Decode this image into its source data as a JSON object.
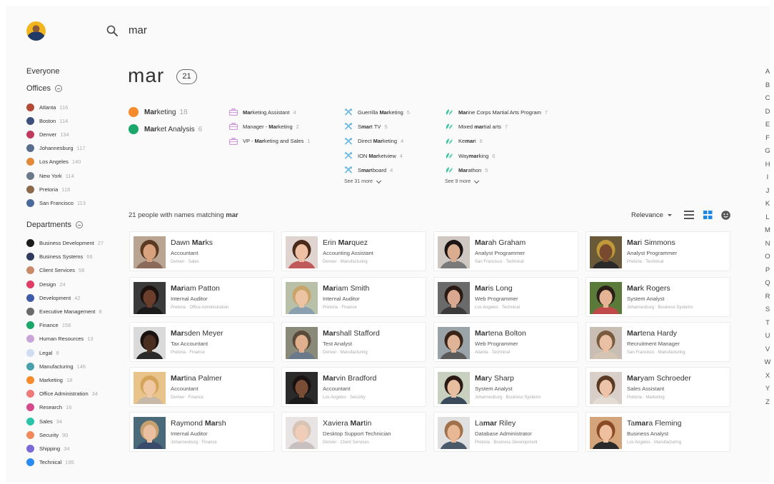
{
  "search": {
    "query": "mar"
  },
  "results": {
    "query": "mar",
    "count": "21",
    "line_prefix": "21 people with names matching ",
    "line_term": "mar"
  },
  "sort": {
    "label": "Relevance"
  },
  "sidebar": {
    "everyone": "Everyone",
    "offices_title": "Offices",
    "departments_title": "Departments",
    "offices": [
      {
        "label": "Atlanta",
        "count": "116",
        "color": "#b24a36"
      },
      {
        "label": "Boston",
        "count": "114",
        "color": "#3b4f7a"
      },
      {
        "label": "Denver",
        "count": "134",
        "color": "#c03a5c"
      },
      {
        "label": "Johannesburg",
        "count": "117",
        "color": "#5a6e8c"
      },
      {
        "label": "Los Angeles",
        "count": "140",
        "color": "#e08a3a"
      },
      {
        "label": "New York",
        "count": "114",
        "color": "#6b7a8a"
      },
      {
        "label": "Pretoria",
        "count": "118",
        "color": "#8a6a4a"
      },
      {
        "label": "San Francisco",
        "count": "113",
        "color": "#4a6a9a"
      }
    ],
    "departments": [
      {
        "label": "Business Development",
        "count": "27",
        "color": "#1c1c1c"
      },
      {
        "label": "Business Systems",
        "count": "66",
        "color": "#2f3a5c"
      },
      {
        "label": "Client Services",
        "count": "58",
        "color": "#c98a6a"
      },
      {
        "label": "Design",
        "count": "24",
        "color": "#e03c64"
      },
      {
        "label": "Development",
        "count": "42",
        "color": "#3f5aa8"
      },
      {
        "label": "Executive Management",
        "count": "8",
        "color": "#6a6a6a"
      },
      {
        "label": "Finance",
        "count": "158",
        "color": "#1aa86a"
      },
      {
        "label": "Human Resources",
        "count": "13",
        "color": "#c9a4d8"
      },
      {
        "label": "Legal",
        "count": "9",
        "color": "#cfdcf2"
      },
      {
        "label": "Manufacturing",
        "count": "146",
        "color": "#4aa0a8"
      },
      {
        "label": "Marketing",
        "count": "18",
        "color": "#f78a2a"
      },
      {
        "label": "Office Administration",
        "count": "34",
        "color": "#f07a7a"
      },
      {
        "label": "Research",
        "count": "16",
        "color": "#d44a8a"
      },
      {
        "label": "Sales",
        "count": "34",
        "color": "#2ac4a8"
      },
      {
        "label": "Security",
        "count": "90",
        "color": "#f08a5a"
      },
      {
        "label": "Shipping",
        "count": "34",
        "color": "#7a6ad8"
      },
      {
        "label": "Technical",
        "count": "195",
        "color": "#2a8af0"
      }
    ]
  },
  "suggestions": {
    "departments": [
      {
        "pre": "",
        "bold": "Mar",
        "post": "keting",
        "count": "18",
        "color": "#f78a2a"
      },
      {
        "pre": "",
        "bold": "Mar",
        "post": "ket Analysis",
        "count": "6",
        "color": "#1aa86a"
      }
    ],
    "roles": [
      {
        "pre": "",
        "bold": "Mar",
        "post": "keting Assistant",
        "count": "4"
      },
      {
        "pre": "Manager - ",
        "bold": "Mar",
        "post": "keting",
        "count": "2"
      },
      {
        "pre": "VP - ",
        "bold": "Mar",
        "post": "keting and Sales",
        "count": "1"
      }
    ],
    "skills": [
      {
        "pre": "Guerrilla ",
        "bold": "Mar",
        "post": "keting",
        "count": "5"
      },
      {
        "pre": "S",
        "bold": "mar",
        "post": "t TV",
        "count": "5"
      },
      {
        "pre": "Direct ",
        "bold": "Mar",
        "post": "keting",
        "count": "4"
      },
      {
        "pre": "ION ",
        "bold": "Mar",
        "post": "ketview",
        "count": "4"
      },
      {
        "pre": "S",
        "bold": "mar",
        "post": "tboard",
        "count": "4"
      }
    ],
    "skills_more": "See 31 more",
    "interests": [
      {
        "pre": "",
        "bold": "Mar",
        "post": "ine Corps Martial Arts Program",
        "count": "7"
      },
      {
        "pre": "Mixed ",
        "bold": "mar",
        "post": "tial arts",
        "count": "7"
      },
      {
        "pre": "Ke",
        "bold": "mar",
        "post": "i",
        "count": "6"
      },
      {
        "pre": "Way",
        "bold": "mar",
        "post": "king",
        "count": "6"
      },
      {
        "pre": "",
        "bold": "Mar",
        "post": "athon",
        "count": "5"
      }
    ],
    "interests_more": "See 9 more"
  },
  "people": [
    {
      "pre": "Dawn ",
      "bold": "Mar",
      "post": "ks",
      "role": "Accountant",
      "loc": "Denver · Sales",
      "bg": "#b9a491",
      "skin": "#d9a27e",
      "hair": "#5a3a22",
      "shirt": "#8a6a5a"
    },
    {
      "pre": "Erin ",
      "bold": "Mar",
      "post": "quez",
      "role": "Accounting Assistant",
      "loc": "Denver · Manufacturing",
      "bg": "#dfd4d0",
      "skin": "#eec0a4",
      "hair": "#4a2a1a",
      "shirt": "#c05a5a"
    },
    {
      "pre": "",
      "bold": "Mar",
      "post": "ah Graham",
      "role": "Analyst Programmer",
      "loc": "San Francisco · Technical",
      "bg": "#cfc7c2",
      "skin": "#d9ad8e",
      "hair": "#1c1414",
      "shirt": "#7a7a7a"
    },
    {
      "pre": "",
      "bold": "Mar",
      "post": "i Simmons",
      "role": "Analyst Programmer",
      "loc": "Pretoria · Technical",
      "bg": "#6a5a3a",
      "skin": "#7a4a2e",
      "hair": "#c09a3a",
      "shirt": "#2a2a2a"
    },
    {
      "pre": "",
      "bold": "Mar",
      "post": "iam Patton",
      "role": "Internal Auditor",
      "loc": "Pretoria · Office Administration",
      "bg": "#3a3a3a",
      "skin": "#6a3e2a",
      "hair": "#1a1210",
      "shirt": "#1a1a1a"
    },
    {
      "pre": "",
      "bold": "Mar",
      "post": "iam Smith",
      "role": "Internal Auditor",
      "loc": "Pretoria · Finance",
      "bg": "#b8c0a8",
      "skin": "#ecc4a4",
      "hair": "#c9a46a",
      "shirt": "#8aa0b0"
    },
    {
      "pre": "",
      "bold": "Mar",
      "post": "is Long",
      "role": "Web Programmer",
      "loc": "Los Angeles · Technical",
      "bg": "#6a6a6a",
      "skin": "#d9a88e",
      "hair": "#2a1a14",
      "shirt": "#3a3a3a"
    },
    {
      "pre": "",
      "bold": "Mar",
      "post": "k Rogers",
      "role": "System Analyst",
      "loc": "Johannesburg · Business Systems",
      "bg": "#5a7a3a",
      "skin": "#e4b494",
      "hair": "#2a1e18",
      "shirt": "#c04a4a"
    },
    {
      "pre": "",
      "bold": "Mar",
      "post": "sden Meyer",
      "role": "Tax Accountant",
      "loc": "Pretoria · Finance",
      "bg": "#dadada",
      "skin": "#4a2e20",
      "hair": "#1a1210",
      "shirt": "#2a2a2a"
    },
    {
      "pre": "",
      "bold": "Mar",
      "post": "shall Stafford",
      "role": "Test Analyst",
      "loc": "Denver · Manufacturing",
      "bg": "#8a8a7a",
      "skin": "#e0b08e",
      "hair": "#5a4a3a",
      "shirt": "#6a7a8a"
    },
    {
      "pre": "",
      "bold": "Mar",
      "post": "tena Bolton",
      "role": "Web Programmer",
      "loc": "Atlanta · Technical",
      "bg": "#9aa4a8",
      "skin": "#e0b496",
      "hair": "#3a2418",
      "shirt": "#5a5a5a"
    },
    {
      "pre": "",
      "bold": "Mar",
      "post": "tena Hardy",
      "role": "Recruitment Manager",
      "loc": "San Francisco · Manufacturing",
      "bg": "#c8beb4",
      "skin": "#eac0a4",
      "hair": "#7a5a3e",
      "shirt": "#d4c4b4"
    },
    {
      "pre": "",
      "bold": "Mar",
      "post": "tina Palmer",
      "role": "Accountant",
      "loc": "Denver · Finance",
      "bg": "#e8c48a",
      "skin": "#f0c8a4",
      "hair": "#d4a45a",
      "shirt": "#c8b8a8"
    },
    {
      "pre": "",
      "bold": "Mar",
      "post": "vin Bradford",
      "role": "Accountant",
      "loc": "Los Angeles · Security",
      "bg": "#2a2a2a",
      "skin": "#7a4e34",
      "hair": "#1a1210",
      "shirt": "#1a1a1a"
    },
    {
      "pre": "",
      "bold": "Mar",
      "post": "y Sharp",
      "role": "System Analyst",
      "loc": "Johannesburg · Business Systems",
      "bg": "#c8d0c0",
      "skin": "#e8bea0",
      "hair": "#2a1a14",
      "shirt": "#3a4a5a"
    },
    {
      "pre": "",
      "bold": "Mar",
      "post": "yam Schroeder",
      "role": "Sales Assistant",
      "loc": "Pretoria · Marketing",
      "bg": "#d8d0c8",
      "skin": "#eec4a8",
      "hair": "#5a3a24",
      "shirt": "#e4dcd4"
    },
    {
      "pre": "Raymond ",
      "bold": "Mar",
      "post": "sh",
      "role": "Internal Auditor",
      "loc": "Johannesburg · Finance",
      "bg": "#4a6a7a",
      "skin": "#eac0a0",
      "hair": "#c8a070",
      "shirt": "#3a4a6a"
    },
    {
      "pre": "Xaviera ",
      "bold": "Mar",
      "post": "tin",
      "role": "Desktop Support Technician",
      "loc": "Denver · Client Services",
      "bg": "#e8e4e4",
      "skin": "#f0cdb8",
      "hair": "#d8c4b4",
      "shirt": "#c8c0c0"
    },
    {
      "pre": "La",
      "bold": "mar",
      "post": " Riley",
      "role": "Database Administrator",
      "loc": "Pretoria · Business Development",
      "bg": "#e0e0e0",
      "skin": "#e8b894",
      "hair": "#a0704a",
      "shirt": "#4a5a6a"
    },
    {
      "pre": "Ta",
      "bold": "mar",
      "post": "a Fleming",
      "role": "Business Analyst",
      "loc": "Los Angeles · Manufacturing",
      "bg": "#d4a47a",
      "skin": "#eec0a0",
      "hair": "#8a4a24",
      "shirt": "#2a2a2a"
    }
  ],
  "alphabet": [
    "A",
    "B",
    "C",
    "D",
    "E",
    "F",
    "G",
    "H",
    "I",
    "J",
    "K",
    "L",
    "M",
    "N",
    "O",
    "P",
    "Q",
    "R",
    "S",
    "T",
    "U",
    "V",
    "W",
    "X",
    "Y",
    "Z"
  ],
  "colors": {
    "accent": "#1e88e5",
    "roles_icon": "#c98ad8",
    "skills_icon": "#6ab8e0",
    "interests_icon": "#3ec4a0"
  }
}
